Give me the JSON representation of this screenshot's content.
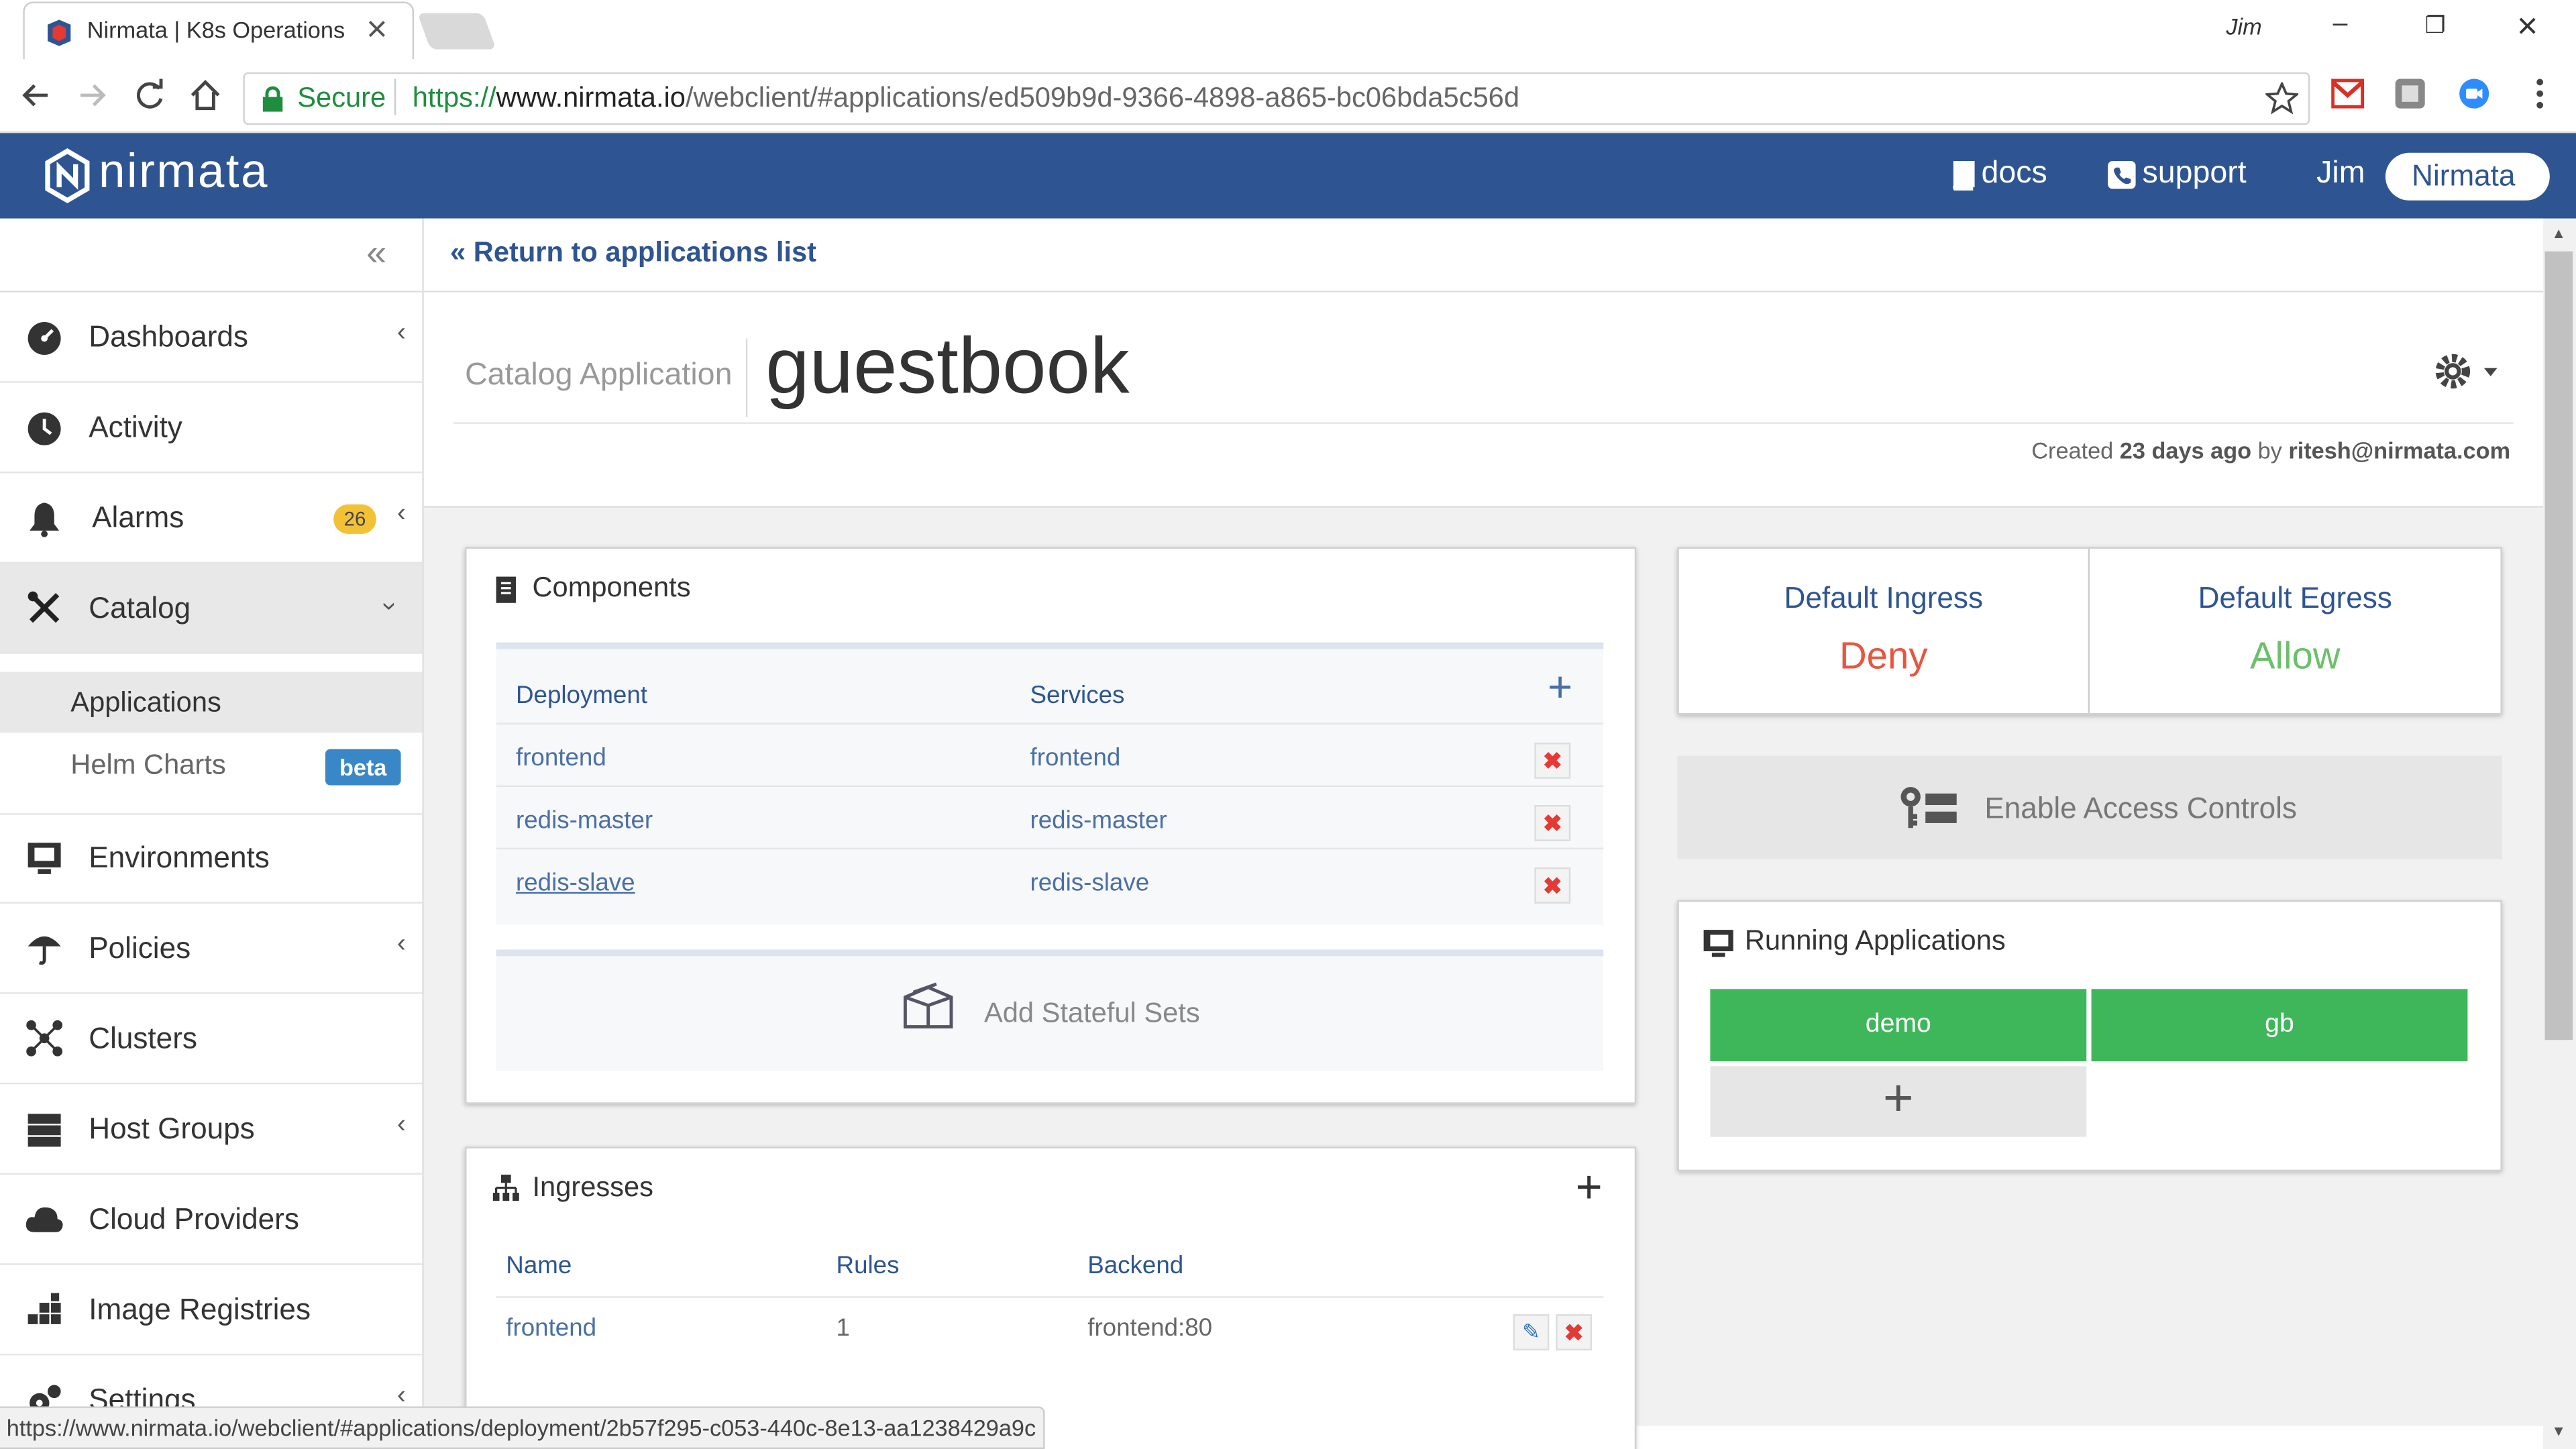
{
  "browser": {
    "tab_title": "Nirmata | K8s Operations",
    "tab_close": "×",
    "user": "Jim",
    "win_min": "–",
    "win_max": "❐",
    "win_close": "×",
    "secure_label": "Secure",
    "url_scheme": "https://",
    "url_host": "www.nirmata.io",
    "url_path": "/webclient/#applications/ed509b9d-9366-4898-a865-bc06bda5c56d",
    "status_url": "https://www.nirmata.io/webclient/#applications/deployment/2b57f295-c053-440c-8e13-aa1238429a9c"
  },
  "header": {
    "logo_text": "nirmata",
    "docs": "docs",
    "support": "support",
    "user": "Jim",
    "org_button": "Nirmata"
  },
  "sidebar": {
    "collapse_icon": "«",
    "items": [
      {
        "label": "Dashboards",
        "icon": "dashboard-icon"
      },
      {
        "label": "Activity",
        "icon": "clock-icon"
      },
      {
        "label": "Alarms",
        "icon": "bell-icon",
        "badge": "26"
      },
      {
        "label": "Catalog",
        "icon": "tools-icon"
      },
      {
        "label": "Environments",
        "icon": "monitor-icon"
      },
      {
        "label": "Policies",
        "icon": "umbrella-icon"
      },
      {
        "label": "Clusters",
        "icon": "cluster-icon"
      },
      {
        "label": "Host Groups",
        "icon": "server-icon"
      },
      {
        "label": "Cloud Providers",
        "icon": "cloud-icon"
      },
      {
        "label": "Image Registries",
        "icon": "registry-icon"
      },
      {
        "label": "Settings",
        "icon": "settings-icon"
      }
    ],
    "sub_items": [
      {
        "label": "Applications"
      },
      {
        "label": "Helm Charts",
        "badge": "beta"
      }
    ]
  },
  "main": {
    "return_link": "Return to applications list",
    "page_subtitle": "Catalog Application",
    "page_title": "guestbook",
    "created_prefix": "Created",
    "created_when": "23 days ago",
    "created_by_word": "by",
    "created_by": "ritesh@nirmata.com"
  },
  "components": {
    "title": "Components",
    "col_deployment": "Deployment",
    "col_services": "Services",
    "rows": [
      {
        "deployment": "frontend",
        "service": "frontend"
      },
      {
        "deployment": "redis-master",
        "service": "redis-master"
      },
      {
        "deployment": "redis-slave",
        "service": "redis-slave"
      }
    ],
    "add_stateful": "Add Stateful Sets"
  },
  "ingresses": {
    "title": "Ingresses",
    "col_name": "Name",
    "col_rules": "Rules",
    "col_backend": "Backend",
    "rows": [
      {
        "name": "frontend",
        "rules": "1",
        "backend": "frontend:80"
      }
    ]
  },
  "network": {
    "ingress_label": "Default Ingress",
    "ingress_value": "Deny",
    "egress_label": "Default Egress",
    "egress_value": "Allow",
    "enable_access": "Enable Access Controls"
  },
  "running": {
    "title": "Running Applications",
    "apps": [
      "demo",
      "gb"
    ],
    "add_symbol": "+"
  },
  "colors": {
    "brand": "#2e5592",
    "deny": "#e8553e",
    "allow": "#6cbf6b",
    "running_green": "#3eb75a",
    "beta_badge": "#3a87c8",
    "alarm_badge": "#f2c135"
  }
}
